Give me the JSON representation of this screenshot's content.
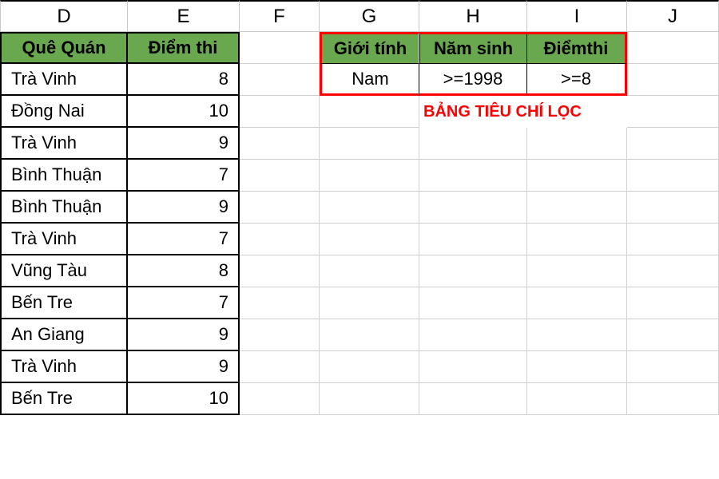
{
  "columns": [
    "D",
    "E",
    "F",
    "G",
    "H",
    "I",
    "J"
  ],
  "headers": {
    "D": "Quê Quán",
    "E": "Điểm thi"
  },
  "rows": [
    {
      "D": "Trà Vinh",
      "E": "8"
    },
    {
      "D": "Đồng Nai",
      "E": "10"
    },
    {
      "D": "Trà Vinh",
      "E": "9"
    },
    {
      "D": "Bình Thuận",
      "E": "7"
    },
    {
      "D": "Bình Thuận",
      "E": "9"
    },
    {
      "D": "Trà Vinh",
      "E": "7"
    },
    {
      "D": "Vũng Tàu",
      "E": "8"
    },
    {
      "D": "Bến Tre",
      "E": "7"
    },
    {
      "D": "An Giang",
      "E": "9"
    },
    {
      "D": "Trà Vinh",
      "E": "9"
    },
    {
      "D": "Bến Tre",
      "E": "10"
    }
  ],
  "criteria": {
    "headers": {
      "G": "Giới tính",
      "H": "Năm sinh",
      "I": "Điểmthi"
    },
    "values": {
      "G": "Nam",
      "H": ">=1998",
      "I": ">=8"
    }
  },
  "caption": "BẢNG TIÊU CHÍ LỌC"
}
